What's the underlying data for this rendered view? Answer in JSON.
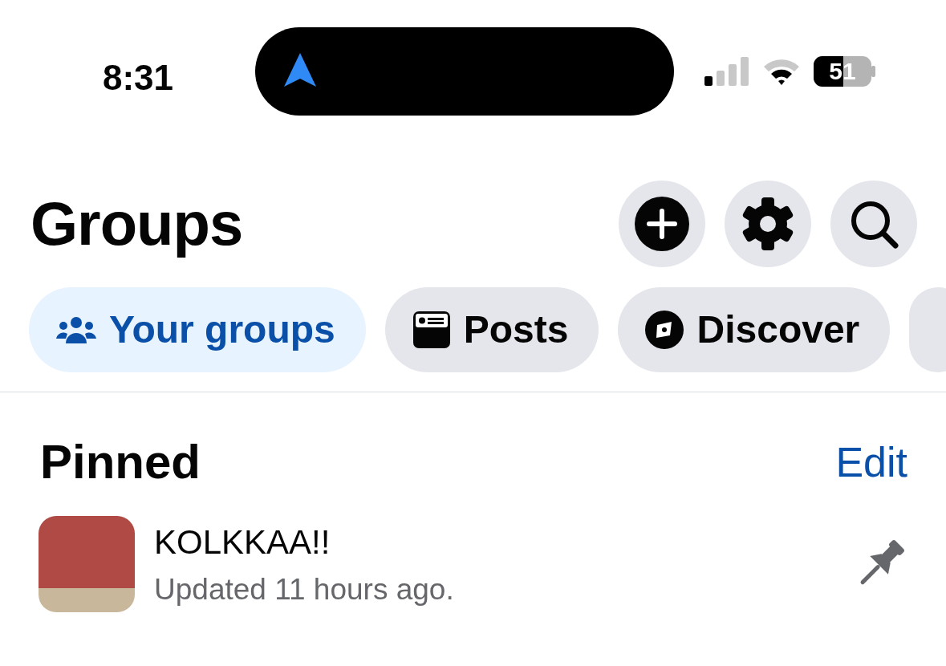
{
  "status_bar": {
    "time": "8:31",
    "battery": "51"
  },
  "header": {
    "title": "Groups"
  },
  "tabs": [
    {
      "label": "Your groups",
      "kind": "people",
      "selected": true
    },
    {
      "label": "Posts",
      "kind": "posts",
      "selected": false
    },
    {
      "label": "Discover",
      "kind": "compass",
      "selected": false
    }
  ],
  "pinned": {
    "title": "Pinned",
    "action": "Edit",
    "groups": [
      {
        "name": "KOLKKAA!!",
        "updated": "Updated 11 hours ago.",
        "pinned": true
      }
    ]
  }
}
